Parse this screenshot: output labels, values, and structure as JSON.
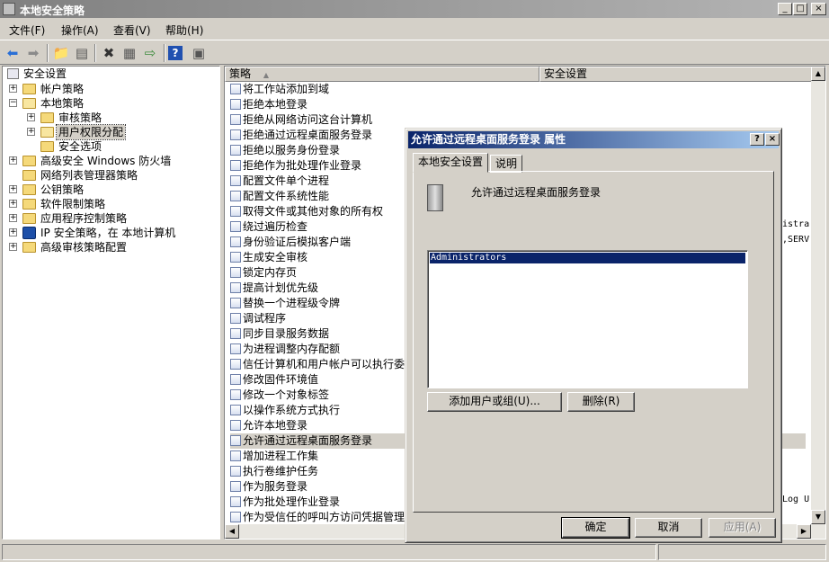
{
  "window": {
    "title": "本地安全策略"
  },
  "menu": [
    "文件(F)",
    "操作(A)",
    "查看(V)",
    "帮助(H)"
  ],
  "toolbar": {
    "icons": [
      "back-icon",
      "forward-icon",
      "up-folder-icon",
      "show-hide-tree-icon",
      "delete-icon",
      "properties-icon",
      "export-list-icon",
      "help-icon",
      "show-hide-pane-icon"
    ]
  },
  "tree": {
    "root": "安全设置",
    "items": [
      {
        "label": "帐户策略"
      },
      {
        "label": "本地策略"
      },
      {
        "label": "审核策略"
      },
      {
        "label": "用户权限分配"
      },
      {
        "label": "安全选项"
      },
      {
        "label": "高级安全 Windows 防火墙"
      },
      {
        "label": "网络列表管理器策略"
      },
      {
        "label": "公钥策略"
      },
      {
        "label": "软件限制策略"
      },
      {
        "label": "应用程序控制策略"
      },
      {
        "label": "IP 安全策略，在 本地计算机"
      },
      {
        "label": "高级审核策略配置"
      }
    ]
  },
  "list": {
    "columns": [
      "策略",
      "安全设置"
    ],
    "rows": [
      "将工作站添加到域",
      "拒绝本地登录",
      "拒绝从网络访问这台计算机",
      "拒绝通过远程桌面服务登录",
      "拒绝以服务身份登录",
      "拒绝作为批处理作业登录",
      "配置文件单个进程",
      "配置文件系统性能",
      "取得文件或其他对象的所有权",
      "绕过遍历检查",
      "身份验证后模拟客户端",
      "生成安全审核",
      "锁定内存页",
      "提高计划优先级",
      "替换一个进程级令牌",
      "调试程序",
      "同步目录服务数据",
      "为进程调整内存配额",
      "信任计算机和用户帐户可以执行委",
      "修改固件环境值",
      "修改一个对象标签",
      "以操作系统方式执行",
      "允许本地登录",
      "允许通过远程桌面服务登录",
      "增加进程工作集",
      "执行卷维护任务",
      "作为服务登录",
      "作为批处理作业登录",
      "作为受信任的呼叫方访问凭据管理"
    ],
    "selected_row": "允许通过远程桌面服务登录",
    "partial_settings": [
      "istra",
      ",SERV",
      "Log U"
    ]
  },
  "dialog": {
    "title": "允许通过远程桌面服务登录 属性",
    "help_btn": "?",
    "close_btn": "×",
    "tabs": [
      "本地安全设置",
      "说明"
    ],
    "policy_name": "允许通过远程桌面服务登录",
    "members": [
      "Administrators"
    ],
    "add_button": "添加用户或组(U)...",
    "remove_button": "删除(R)",
    "ok": "确定",
    "cancel": "取消",
    "apply": "应用(A)"
  }
}
